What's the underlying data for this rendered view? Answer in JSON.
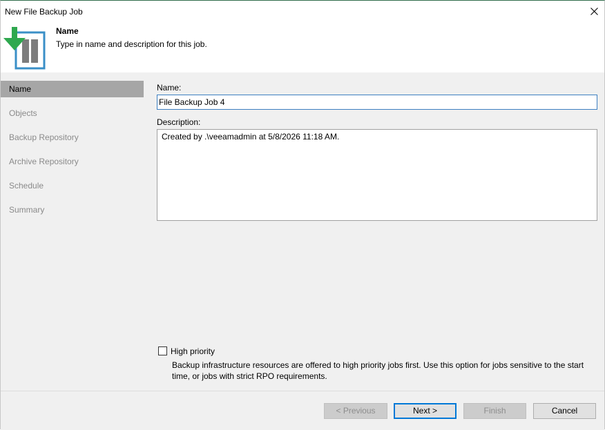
{
  "window": {
    "title": "New File Backup Job"
  },
  "header": {
    "title": "Name",
    "subtitle": "Type in name and description for this job."
  },
  "steps": [
    {
      "label": "Name"
    },
    {
      "label": "Objects"
    },
    {
      "label": "Backup Repository"
    },
    {
      "label": "Archive Repository"
    },
    {
      "label": "Schedule"
    },
    {
      "label": "Summary"
    }
  ],
  "form": {
    "name_label": "Name:",
    "name_value": "File Backup Job 4",
    "description_label": "Description:",
    "description_value": "Created by .\\veeamadmin at 5/8/2026 11:18 AM.",
    "high_priority_label": "High priority",
    "high_priority_checked": false,
    "high_priority_note": "Backup infrastructure resources are offered to high priority jobs first. Use this option for jobs sensitive to the start time, or jobs with strict RPO requirements."
  },
  "buttons": {
    "previous": "< Previous",
    "next": "Next >",
    "finish": "Finish",
    "cancel": "Cancel"
  },
  "colors": {
    "accent": "#0078d7",
    "logo_green": "#2fa84f",
    "logo_blue": "#3a8fc7"
  }
}
